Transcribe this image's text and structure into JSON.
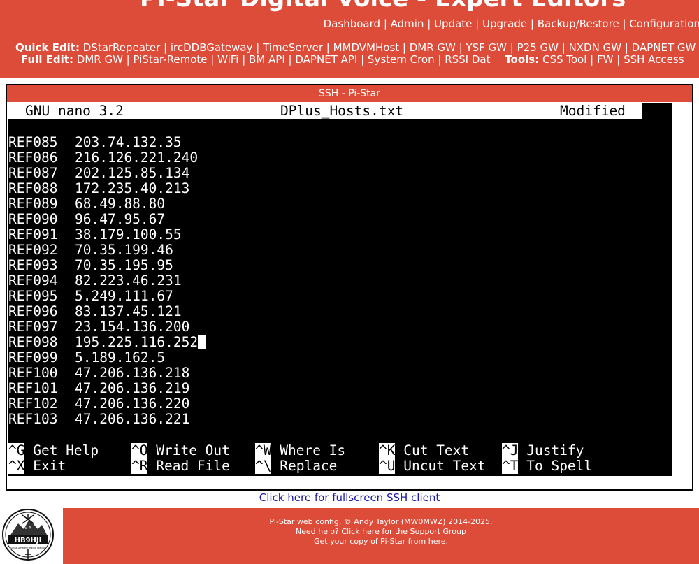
{
  "header": {
    "title": "Pi-Star Digital Voice - Expert Editors",
    "nav": [
      "Dashboard",
      "Admin",
      "Update",
      "Upgrade",
      "Backup/Restore",
      "Configuration"
    ],
    "quick_edit_label": "Quick Edit:",
    "quick_edit": [
      "DStarRepeater",
      "ircDDBGateway",
      "TimeServer",
      "MMDVMHost",
      "DMR GW",
      "YSF GW",
      "P25 GW",
      "NXDN GW",
      "DAPNET GW"
    ],
    "full_edit_label": "Full Edit:",
    "full_edit": [
      "DMR GW",
      "PiStar-Remote",
      "WiFi",
      "BM API",
      "DAPNET API",
      "System Cron",
      "RSSI Dat"
    ],
    "tools_label": "Tools:",
    "tools": [
      "CSS Tool",
      "FW",
      "SSH Access"
    ]
  },
  "panel": {
    "title": "SSH - Pi-Star"
  },
  "nano": {
    "version": "GNU nano 3.2",
    "filename": "DPlus_Hosts.txt",
    "state": "Modified",
    "lines": [
      {
        "host": "REF085",
        "ip": "203.74.132.35"
      },
      {
        "host": "REF086",
        "ip": "216.126.221.240"
      },
      {
        "host": "REF087",
        "ip": "202.125.85.134"
      },
      {
        "host": "REF088",
        "ip": "172.235.40.213"
      },
      {
        "host": "REF089",
        "ip": "68.49.88.80"
      },
      {
        "host": "REF090",
        "ip": "96.47.95.67"
      },
      {
        "host": "REF091",
        "ip": "38.179.100.55"
      },
      {
        "host": "REF092",
        "ip": "70.35.199.46"
      },
      {
        "host": "REF093",
        "ip": "70.35.195.95"
      },
      {
        "host": "REF094",
        "ip": "82.223.46.231"
      },
      {
        "host": "REF095",
        "ip": "5.249.111.67"
      },
      {
        "host": "REF096",
        "ip": "83.137.45.121"
      },
      {
        "host": "REF097",
        "ip": "23.154.136.200"
      },
      {
        "host": "REF098",
        "ip": "195.225.116.252"
      },
      {
        "host": "REF099",
        "ip": "5.189.162.5"
      },
      {
        "host": "REF100",
        "ip": "47.206.136.218"
      },
      {
        "host": "REF101",
        "ip": "47.206.136.219"
      },
      {
        "host": "REF102",
        "ip": "47.206.136.220"
      },
      {
        "host": "REF103",
        "ip": "47.206.136.221"
      }
    ],
    "shortcuts": [
      [
        {
          "key": "^G",
          "desc": "Get Help"
        },
        {
          "key": "^O",
          "desc": "Write Out"
        },
        {
          "key": "^W",
          "desc": "Where Is"
        },
        {
          "key": "^K",
          "desc": "Cut Text"
        },
        {
          "key": "^J",
          "desc": "Justify"
        }
      ],
      [
        {
          "key": "^X",
          "desc": "Exit"
        },
        {
          "key": "^R",
          "desc": "Read File"
        },
        {
          "key": "^\\",
          "desc": "Replace"
        },
        {
          "key": "^U",
          "desc": "Uncut Text"
        },
        {
          "key": "^T",
          "desc": "To Spell"
        }
      ]
    ]
  },
  "fullscreen_link": "Click here for fullscreen SSH client",
  "footer": {
    "line1": "Pi-Star web config, © Andy Taylor (MW0MWZ) 2014-2025.",
    "line2": "Need help? Click here for the Support Group",
    "line3": "Get your copy of Pi-Star from here.",
    "logo_callsign": "HB9HJI",
    "logo_text": "Swiss Amateur Radio Station",
    "logo_letters": "V  X"
  },
  "colors": {
    "brand_red": "#dd4b39",
    "link_blue": "#1a1aa6",
    "terminal_bg": "#000000"
  }
}
